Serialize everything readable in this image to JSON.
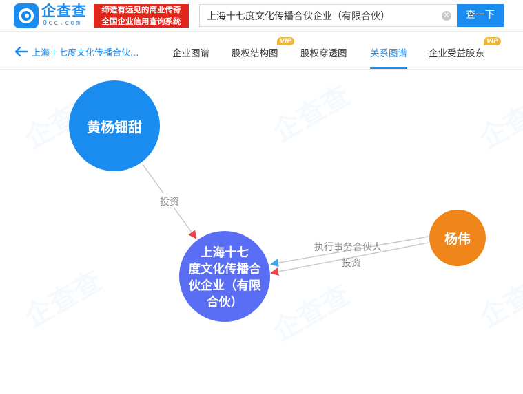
{
  "header": {
    "brand_name": "企查查",
    "brand_domain": "Qcc.com",
    "slogan_line1": "缔造有远见的商业传奇",
    "slogan_line2": "全国企业信用查询系统",
    "search_value": "上海十七度文化传播合伙企业（有限合伙）",
    "search_button": "查一下",
    "clear_icon": "close-circle-icon"
  },
  "nav": {
    "back_label": "上海十七度文化传播合伙...",
    "tabs": [
      {
        "label": "企业图谱",
        "vip": ""
      },
      {
        "label": "股权结构图",
        "vip": "VIP"
      },
      {
        "label": "股权穿透图",
        "vip": ""
      },
      {
        "label": "关系图谱",
        "vip": "",
        "active": true
      },
      {
        "label": "企业受益股东",
        "vip": "VIP"
      }
    ]
  },
  "graph": {
    "nodes": {
      "person1": {
        "label": "黄杨钿甜",
        "color": "#1a8cf0"
      },
      "person2": {
        "label": "杨伟",
        "color": "#f08519"
      },
      "company": {
        "label_lines": [
          "上海十七",
          "度文化传播合",
          "伙企业（有限",
          "合伙）"
        ],
        "color": "#5a6df5"
      }
    },
    "edges": {
      "person1_company": "投资",
      "person2_company_role": "执行事务合伙人",
      "person2_company_invest": "投资"
    },
    "arrow_colors": {
      "invest": "#e8434b",
      "role": "#3ea4ee"
    },
    "watermark": "企查查"
  }
}
